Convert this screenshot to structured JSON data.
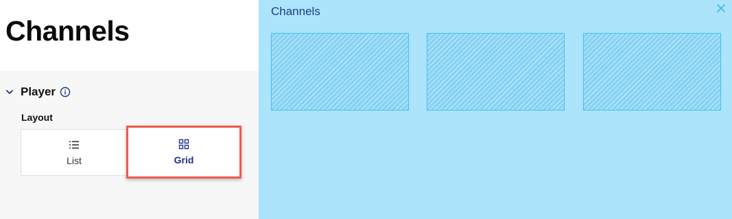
{
  "page": {
    "title": "Channels"
  },
  "settings": {
    "section_title": "Player",
    "layout_label": "Layout",
    "layout_options": [
      {
        "label": "List",
        "icon": "list-icon",
        "selected": false
      },
      {
        "label": "Grid",
        "icon": "grid-icon",
        "selected": true
      }
    ]
  },
  "preview": {
    "title": "Channels",
    "close_icon": "close-icon",
    "tile_count": 3
  },
  "colors": {
    "accent": "#1c2f8a",
    "highlight": "#ee5a4c",
    "preview_bg": "#abe4fb",
    "tile_border": "#46c0ee"
  },
  "icons": {
    "section_toggle": "chevron-down-icon",
    "section_info": "info-icon"
  }
}
